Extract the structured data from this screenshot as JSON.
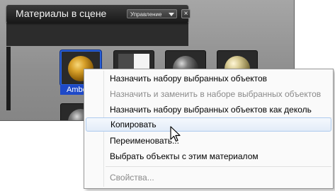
{
  "palette": {
    "title": "Материалы в сцене",
    "manage_dropdown": "Управление",
    "close_label": "×",
    "selected_material_name": "Ambe",
    "swatches": [
      {
        "name": "amber-material-swatch",
        "kind": "amber-sphere",
        "selected": true
      },
      {
        "name": "decal-material-swatch",
        "kind": "decal-tile",
        "selected": false
      },
      {
        "name": "dark-gray-material-swatch",
        "kind": "dark-sphere",
        "selected": false
      },
      {
        "name": "tan-material-swatch",
        "kind": "tan-sphere",
        "selected": false
      },
      {
        "name": "dark-material-swatch-row2",
        "kind": "dark-sphere",
        "selected": false
      }
    ]
  },
  "context_menu": {
    "items": [
      {
        "label": "Назначить набору выбранных объектов",
        "enabled": true
      },
      {
        "label": "Назначить и заменить в наборе выбранных объектов",
        "enabled": false
      },
      {
        "label": "Назначить набору выбранных объектов как деколь",
        "enabled": true
      },
      {
        "label": "Копировать",
        "enabled": true,
        "hovered": true
      },
      {
        "label": "Переименовать...",
        "enabled": true
      },
      {
        "label": "Выбрать объекты с этим материалом",
        "enabled": true
      },
      {
        "label": "Свойства...",
        "enabled": false
      }
    ]
  },
  "colors": {
    "selection_blue": "#1e49c8",
    "menu_hover_border": "#aecbef",
    "disabled_text": "#8a8a8a"
  }
}
